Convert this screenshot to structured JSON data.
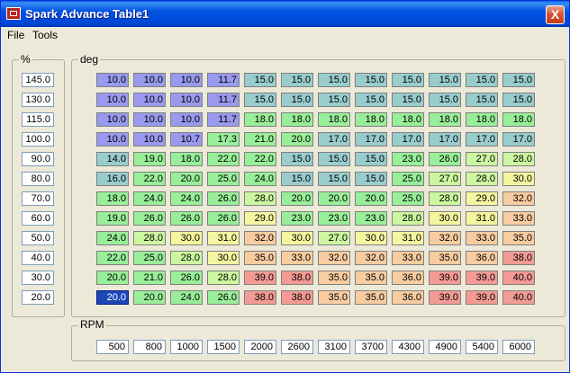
{
  "window": {
    "title": "Spark Advance Table1",
    "close_label": "X"
  },
  "menu": {
    "items": [
      "File",
      "Tools"
    ]
  },
  "load_group": {
    "label": "%",
    "values": [
      "145.0",
      "130.0",
      "115.0",
      "100.0",
      "90.0",
      "80.0",
      "70.0",
      "60.0",
      "50.0",
      "40.0",
      "30.0",
      "20.0"
    ]
  },
  "table_group": {
    "label": "deg"
  },
  "rpm_group": {
    "label": "RPM",
    "values": [
      "500",
      "800",
      "1000",
      "1500",
      "2000",
      "2600",
      "3100",
      "3700",
      "4300",
      "4900",
      "5400",
      "6000"
    ]
  },
  "selected_cell": {
    "row": 11,
    "col": 0
  },
  "colors": {
    "blue": "#9999ee",
    "teal": "#99cccc",
    "green": "#99ee99",
    "lime": "#ccf7a0",
    "yellow": "#f5f5a0",
    "peach": "#f7cca0",
    "salmon": "#f39a94"
  },
  "table": [
    [
      "10.0",
      "10.0",
      "10.0",
      "11.7",
      "15.0",
      "15.0",
      "15.0",
      "15.0",
      "15.0",
      "15.0",
      "15.0",
      "15.0"
    ],
    [
      "10.0",
      "10.0",
      "10.0",
      "11.7",
      "15.0",
      "15.0",
      "15.0",
      "15.0",
      "15.0",
      "15.0",
      "15.0",
      "15.0"
    ],
    [
      "10.0",
      "10.0",
      "10.0",
      "11.7",
      "18.0",
      "18.0",
      "18.0",
      "18.0",
      "18.0",
      "18.0",
      "18.0",
      "18.0"
    ],
    [
      "10.0",
      "10.0",
      "10.7",
      "17.3",
      "21.0",
      "20.0",
      "17.0",
      "17.0",
      "17.0",
      "17.0",
      "17.0",
      "17.0"
    ],
    [
      "14.0",
      "19.0",
      "18.0",
      "22.0",
      "22.0",
      "15.0",
      "15.0",
      "15.0",
      "23.0",
      "26.0",
      "27.0",
      "28.0"
    ],
    [
      "16.0",
      "22.0",
      "20.0",
      "25.0",
      "24.0",
      "15.0",
      "15.0",
      "15.0",
      "25.0",
      "27.0",
      "28.0",
      "30.0"
    ],
    [
      "18.0",
      "24.0",
      "24.0",
      "26.0",
      "28.0",
      "20.0",
      "20.0",
      "20.0",
      "25.0",
      "28.0",
      "29.0",
      "32.0"
    ],
    [
      "19.0",
      "26.0",
      "26.0",
      "26.0",
      "29.0",
      "23.0",
      "23.0",
      "23.0",
      "28.0",
      "30.0",
      "31.0",
      "33.0"
    ],
    [
      "24.0",
      "28.0",
      "30.0",
      "31.0",
      "32.0",
      "30.0",
      "27.0",
      "30.0",
      "31.0",
      "32.0",
      "33.0",
      "35.0"
    ],
    [
      "22.0",
      "25.0",
      "28.0",
      "30.0",
      "35.0",
      "33.0",
      "32.0",
      "32.0",
      "33.0",
      "35.0",
      "36.0",
      "38.0"
    ],
    [
      "20.0",
      "21.0",
      "26.0",
      "28.0",
      "39.0",
      "38.0",
      "35.0",
      "35.0",
      "36.0",
      "39.0",
      "39.0",
      "40.0"
    ],
    [
      "20.0",
      "20.0",
      "24.0",
      "26.0",
      "38.0",
      "38.0",
      "35.0",
      "35.0",
      "36.0",
      "39.0",
      "39.0",
      "40.0"
    ]
  ]
}
